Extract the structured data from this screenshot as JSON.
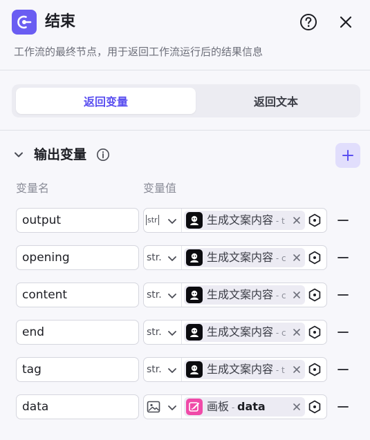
{
  "header": {
    "title": "结束",
    "description": "工作流的最终节点，用于返回工作流运行后的结果信息"
  },
  "tabs": [
    {
      "label": "返回变量",
      "active": true
    },
    {
      "label": "返回文本",
      "active": false
    }
  ],
  "section": {
    "title": "输出变量",
    "col_name": "变量名",
    "col_value": "变量值"
  },
  "rows": [
    {
      "name": "output",
      "type": "str",
      "type_display": "str_badge",
      "ref_icon": "workflow-node-icon",
      "ref_label": "生成文案内容",
      "ref_suffix": " - t"
    },
    {
      "name": "opening",
      "type": "str.",
      "type_display": "text",
      "ref_icon": "workflow-node-icon",
      "ref_label": "生成文案内容",
      "ref_suffix": " - c"
    },
    {
      "name": "content",
      "type": "str.",
      "type_display": "text",
      "ref_icon": "workflow-node-icon",
      "ref_label": "生成文案内容",
      "ref_suffix": " - c"
    },
    {
      "name": "end",
      "type": "str.",
      "type_display": "text",
      "ref_icon": "workflow-node-icon",
      "ref_label": "生成文案内容",
      "ref_suffix": " - c"
    },
    {
      "name": "tag",
      "type": "str.",
      "type_display": "text",
      "ref_icon": "workflow-node-icon",
      "ref_label": "生成文案内容",
      "ref_suffix": " - t"
    },
    {
      "name": "data",
      "type": "image",
      "type_display": "image_icon",
      "ref_icon": "canvas-icon",
      "ref_label": "画板",
      "ref_suffix": " - ",
      "ref_field": "data"
    }
  ],
  "colors": {
    "accent": "#5a4ff0",
    "node_icon_bg": "#6a5df2",
    "add_button_bg": "#e1defc",
    "canvas_icon_bg": "#f04aa8"
  }
}
